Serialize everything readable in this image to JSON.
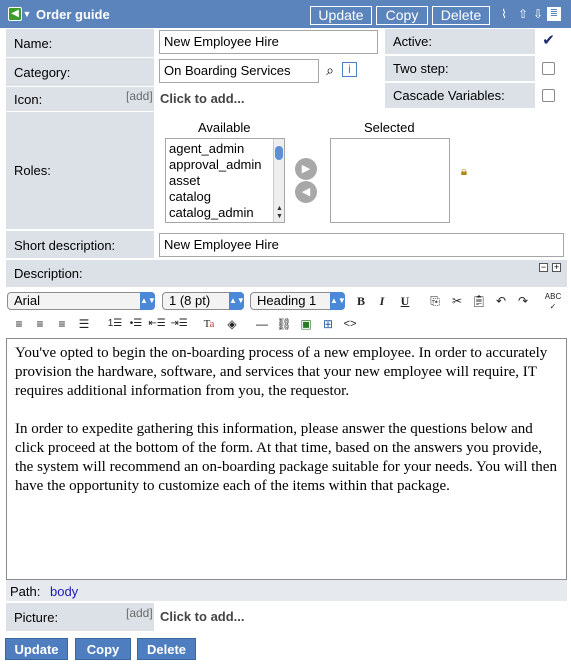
{
  "header": {
    "title": "Order guide",
    "update_label": "Update",
    "copy_label": "Copy",
    "delete_label": "Delete"
  },
  "form": {
    "name_label": "Name:",
    "name_value": "New Employee Hire",
    "category_label": "Category:",
    "category_value": "On Boarding Services",
    "icon_label": "Icon:",
    "add_label": "[add]",
    "click_to_add": "Click to add...",
    "active_label": "Active:",
    "active_checked": "✔",
    "two_step_label": "Two step:",
    "cascade_label": "Cascade Variables:",
    "roles_label": "Roles:",
    "available_label": "Available",
    "selected_label": "Selected",
    "available_roles": [
      "agent_admin",
      "approval_admin",
      "asset",
      "catalog",
      "catalog_admin"
    ],
    "short_desc_label": "Short description:",
    "short_desc_value": "New Employee Hire",
    "description_label": "Description:"
  },
  "toolbar": {
    "font": "Arial",
    "size": "1 (8 pt)",
    "format": "Heading 1"
  },
  "editor": {
    "paragraph1": "You've opted to begin the on-boarding process of a new employee. In order to accurately provision the hardware, software, and services that your new employee will require, IT requires additional information from you, the requestor.",
    "paragraph2": "In order to expedite gathering this information, please answer the questions below and click proceed at the bottom of the form. At that time, based on the answers you provide, the system will recommend an on-boarding package suitable for your needs. You will then have the opportunity to customize each of the items within that package."
  },
  "path": {
    "label": "Path:",
    "value": "body"
  },
  "picture": {
    "label": "Picture:",
    "add_label": "[add]",
    "click_to_add": "Click to add..."
  },
  "footer": {
    "update_label": "Update",
    "copy_label": "Copy",
    "delete_label": "Delete"
  },
  "colors": {
    "header_bg": "#5b84bd",
    "label_bg": "#dce1e8",
    "button_bg": "#4f7ec0",
    "path_link": "#1a1ab8"
  }
}
